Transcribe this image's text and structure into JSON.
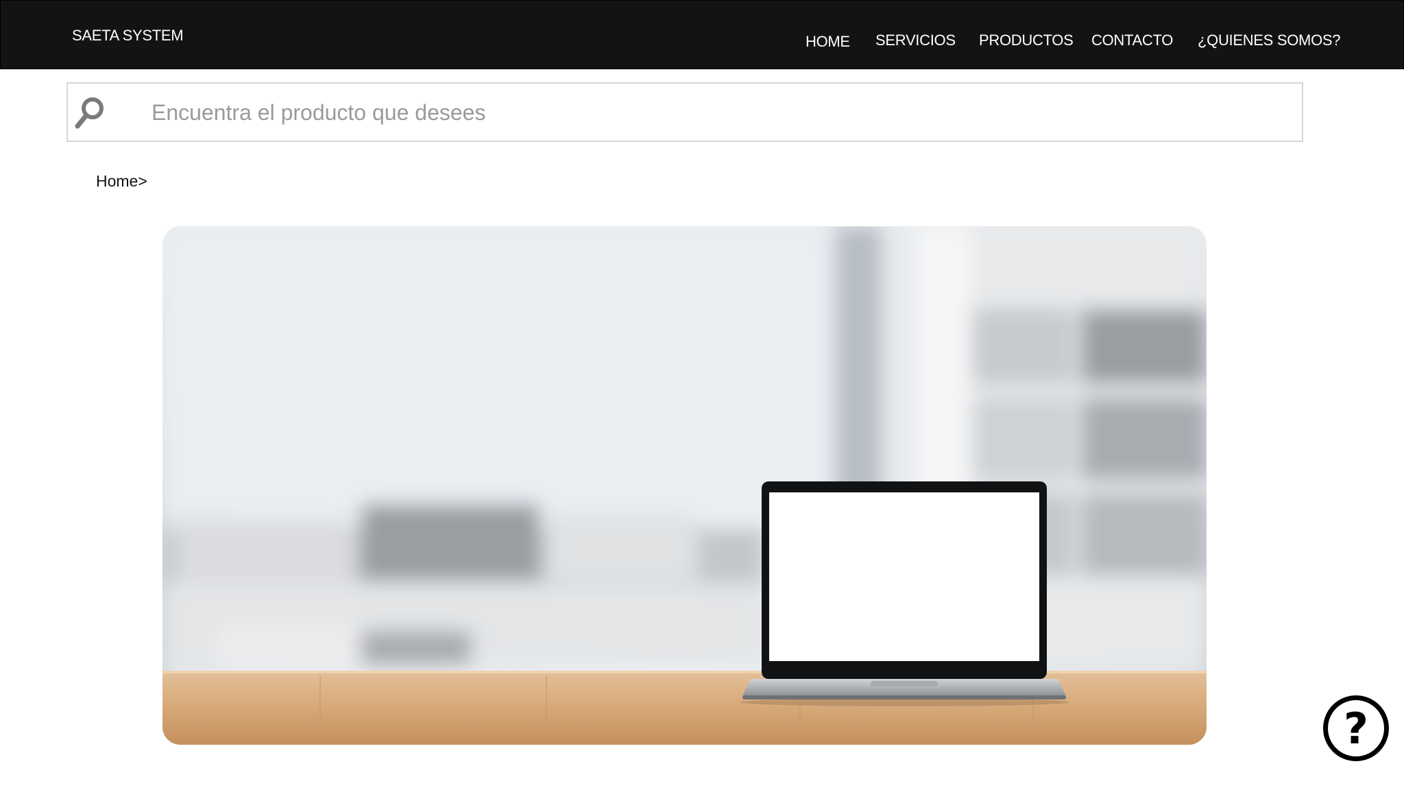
{
  "header": {
    "brand": "SAETA SYSTEM",
    "nav": {
      "home": "HOME",
      "servicios": "SERVICIOS",
      "productos": "PRODUCTOS",
      "contacto": "CONTACTO",
      "quienes": "¿QUIENES SOMOS?"
    }
  },
  "search": {
    "placeholder": "Encuentra el producto que desees",
    "value": "",
    "icon": "search-icon"
  },
  "breadcrumb": {
    "text": "Home>"
  },
  "hero": {
    "icon": "laptop-on-desk-image"
  },
  "help": {
    "glyph": "?",
    "icon": "help-icon"
  },
  "colors": {
    "topbar": "#131313",
    "nav_text": "#ffffff",
    "search_border": "#d7d7d7",
    "placeholder": "#9a9a9a",
    "desk_wood": "#d6a878"
  }
}
